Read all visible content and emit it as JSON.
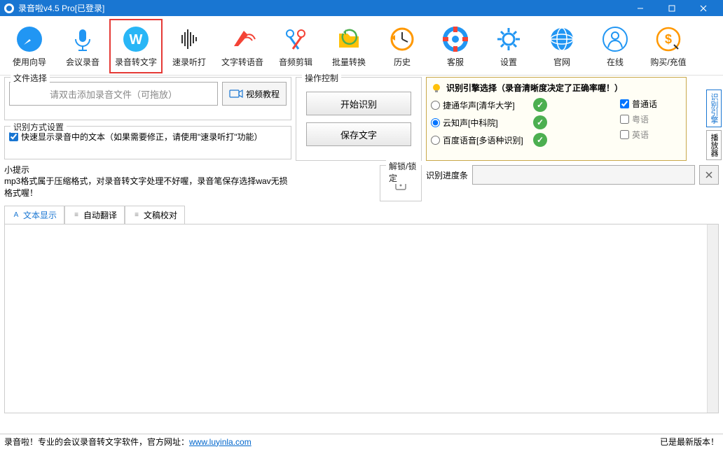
{
  "title": "录音啦v4.5 Pro[已登录]",
  "toolbar": [
    {
      "id": "guide",
      "label": "使用向导"
    },
    {
      "id": "record",
      "label": "会议录音"
    },
    {
      "id": "stt",
      "label": "录音转文字",
      "selected": true
    },
    {
      "id": "fast",
      "label": "速录听打"
    },
    {
      "id": "tts",
      "label": "文字转语音"
    },
    {
      "id": "audioedit",
      "label": "音频剪辑"
    },
    {
      "id": "batch",
      "label": "批量转换"
    },
    {
      "id": "history",
      "label": "历史"
    },
    {
      "id": "service",
      "label": "客服"
    },
    {
      "id": "settings",
      "label": "设置"
    },
    {
      "id": "site",
      "label": "官网"
    },
    {
      "id": "online",
      "label": "在线"
    },
    {
      "id": "buy",
      "label": "购买/充值"
    }
  ],
  "fileSelect": {
    "title": "文件选择",
    "placeholder": "请双击添加录音文件（可拖放）",
    "videoBtn": "视频教程"
  },
  "recogMode": {
    "title": "识别方式设置",
    "checkboxLabel": "快速显示录音中的文本（如果需要修正，请使用\"速录听打\"功能）",
    "checked": true
  },
  "tips": {
    "title": "小提示",
    "text": "mp3格式属于压缩格式，对录音转文字处理不好喔，录音笔保存选择wav无损格式喔！"
  },
  "opControl": {
    "title": "操作控制",
    "startBtn": "开始识别",
    "saveBtn": "保存文字"
  },
  "lock": {
    "title": "解锁/锁定"
  },
  "engine": {
    "title": "识别引擎选择（录音清晰度决定了正确率喔！）",
    "options": [
      {
        "label": "捷通华声[清华大学]",
        "value": "jietong",
        "checked": false
      },
      {
        "label": "云知声[中科院]",
        "value": "yunzhi",
        "checked": true
      },
      {
        "label": "百度语音[多语种识别]",
        "value": "baidu",
        "checked": false
      }
    ],
    "langs": [
      {
        "label": "普通话",
        "checked": true,
        "active": true
      },
      {
        "label": "粤语",
        "checked": false,
        "active": false
      },
      {
        "label": "英语",
        "checked": false,
        "active": false
      }
    ]
  },
  "progress": {
    "label": "识别进度条"
  },
  "tabs": [
    {
      "label": "文本显示",
      "active": true,
      "icon": "A"
    },
    {
      "label": "自动翻译",
      "active": false,
      "icon": "≡"
    },
    {
      "label": "文稿校对",
      "active": false,
      "icon": "≡"
    }
  ],
  "sideTabs": [
    {
      "label": "识别引擎",
      "style": "blue"
    },
    {
      "label": "播放器",
      "style": ""
    }
  ],
  "status": {
    "left": "录音啦！专业的会议录音转文字软件，官方网址：",
    "url": "www.luyinla.com",
    "right": "已是最新版本！"
  }
}
